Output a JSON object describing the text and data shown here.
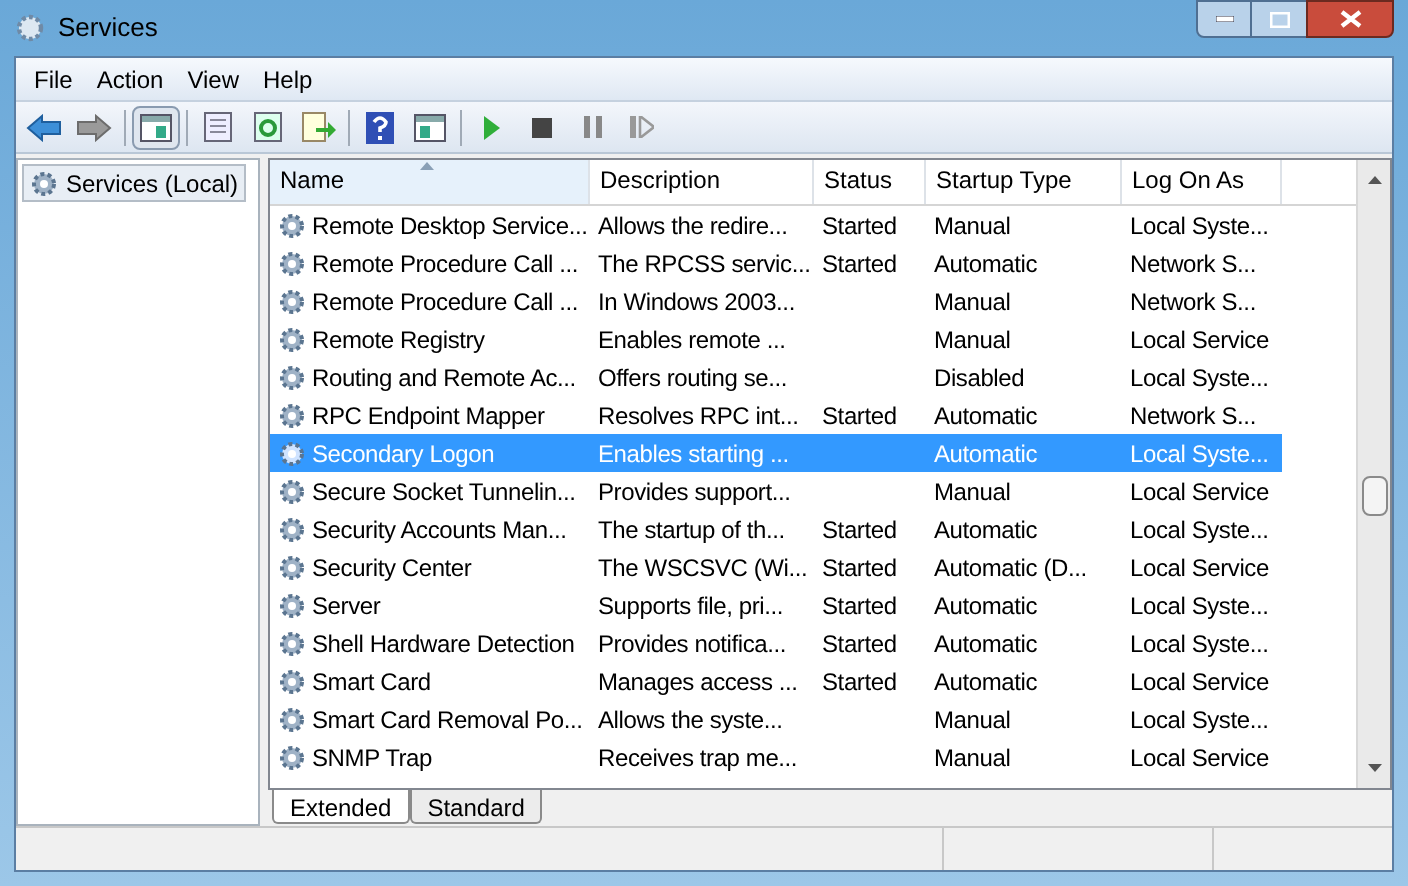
{
  "window": {
    "title": "Services"
  },
  "menu": [
    "File",
    "Action",
    "View",
    "Help"
  ],
  "tree": {
    "label": "Services (Local)",
    "selected": true
  },
  "table": {
    "columns": [
      "Name",
      "Description",
      "Status",
      "Startup Type",
      "Log On As"
    ],
    "rows": [
      {
        "name": "Remote Desktop Service...",
        "description": "Allows the redire...",
        "status": "Started",
        "startup": "Manual",
        "logon": "Local Syste...",
        "selected": false
      },
      {
        "name": "Remote Procedure Call ...",
        "description": "The RPCSS servic...",
        "status": "Started",
        "startup": "Automatic",
        "logon": "Network S...",
        "selected": false
      },
      {
        "name": "Remote Procedure Call ...",
        "description": "In Windows 2003...",
        "status": "",
        "startup": "Manual",
        "logon": "Network S...",
        "selected": false
      },
      {
        "name": "Remote Registry",
        "description": "Enables remote ...",
        "status": "",
        "startup": "Manual",
        "logon": "Local Service",
        "selected": false
      },
      {
        "name": "Routing and Remote Ac...",
        "description": "Offers routing se...",
        "status": "",
        "startup": "Disabled",
        "logon": "Local Syste...",
        "selected": false
      },
      {
        "name": "RPC Endpoint Mapper",
        "description": "Resolves RPC int...",
        "status": "Started",
        "startup": "Automatic",
        "logon": "Network S...",
        "selected": false
      },
      {
        "name": "Secondary Logon",
        "description": "Enables starting ...",
        "status": "",
        "startup": "Automatic",
        "logon": "Local Syste...",
        "selected": true
      },
      {
        "name": "Secure Socket Tunnelin...",
        "description": "Provides support...",
        "status": "",
        "startup": "Manual",
        "logon": "Local Service",
        "selected": false
      },
      {
        "name": "Security Accounts Man...",
        "description": "The startup of th...",
        "status": "Started",
        "startup": "Automatic",
        "logon": "Local Syste...",
        "selected": false
      },
      {
        "name": "Security Center",
        "description": "The WSCSVC (Wi...",
        "status": "Started",
        "startup": "Automatic (D...",
        "logon": "Local Service",
        "selected": false
      },
      {
        "name": "Server",
        "description": "Supports file, pri...",
        "status": "Started",
        "startup": "Automatic",
        "logon": "Local Syste...",
        "selected": false
      },
      {
        "name": "Shell Hardware Detection",
        "description": "Provides notifica...",
        "status": "Started",
        "startup": "Automatic",
        "logon": "Local Syste...",
        "selected": false
      },
      {
        "name": "Smart Card",
        "description": "Manages access ...",
        "status": "Started",
        "startup": "Automatic",
        "logon": "Local Service",
        "selected": false
      },
      {
        "name": "Smart Card Removal Po...",
        "description": "Allows the syste...",
        "status": "",
        "startup": "Manual",
        "logon": "Local Syste...",
        "selected": false
      },
      {
        "name": "SNMP Trap",
        "description": "Receives trap me...",
        "status": "",
        "startup": "Manual",
        "logon": "Local Service",
        "selected": false
      }
    ]
  },
  "view_tabs": [
    {
      "label": "Extended",
      "selected": true
    },
    {
      "label": "Standard",
      "selected": false
    }
  ]
}
